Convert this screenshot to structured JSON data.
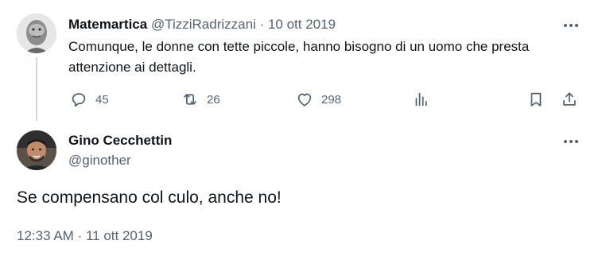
{
  "parent_tweet": {
    "author_name": "Matemartica",
    "author_handle": "@TizziRadrizzani",
    "separator": "·",
    "date": "10 ott 2019",
    "text": "Comunque, le donne con tette piccole, hanno bisogno di un uomo che presta attenzione ai dettagli.",
    "actions": {
      "reply_count": "45",
      "retweet_count": "26",
      "like_count": "298",
      "icons": [
        "reply-icon",
        "retweet-icon",
        "like-icon",
        "views-icon",
        "bookmark-icon",
        "share-icon"
      ]
    }
  },
  "reply_tweet": {
    "author_name": "Gino Cecchettin",
    "author_handle": "@ginother",
    "text": "Se compensano col culo, anche no!",
    "time": "12:33 AM",
    "separator": "·",
    "date": "11 ott 2019"
  },
  "colors": {
    "text": "#0f1419",
    "muted": "#536471",
    "thread_line": "#cfd9de",
    "background": "#ffffff"
  }
}
